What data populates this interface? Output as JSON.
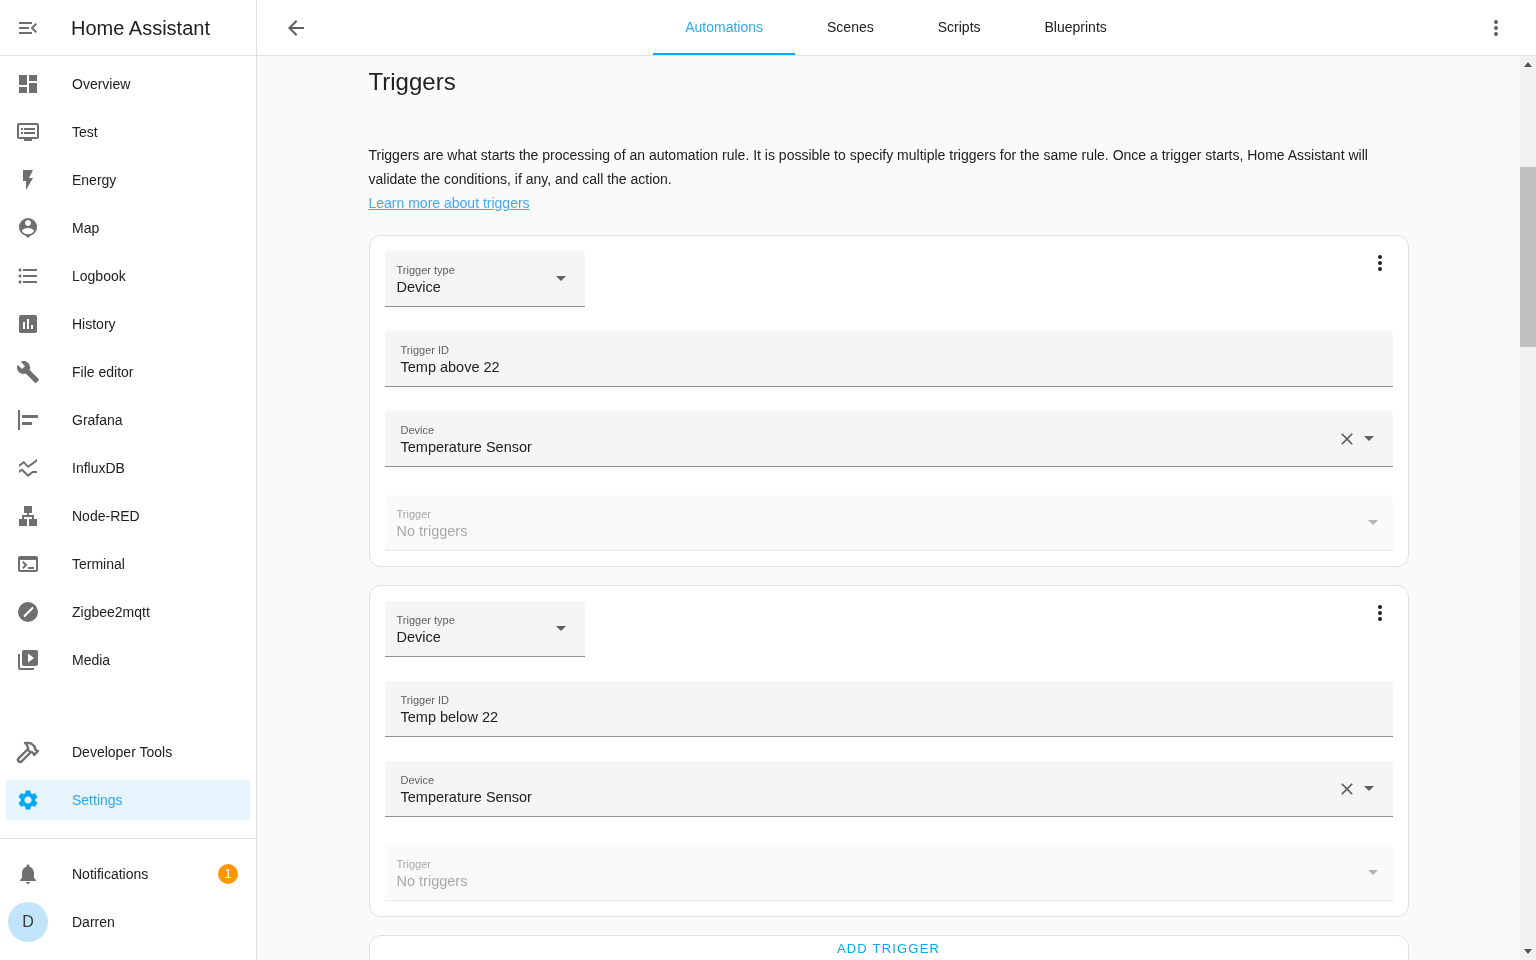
{
  "sidebar": {
    "title": "Home Assistant",
    "panels": [
      {
        "label": "Overview",
        "selected": false
      },
      {
        "label": "Test",
        "selected": false
      },
      {
        "label": "Energy",
        "selected": false
      },
      {
        "label": "Map",
        "selected": false
      },
      {
        "label": "Logbook",
        "selected": false
      },
      {
        "label": "History",
        "selected": false
      },
      {
        "label": "File editor",
        "selected": false
      },
      {
        "label": "Grafana",
        "selected": false
      },
      {
        "label": "InfluxDB",
        "selected": false
      },
      {
        "label": "Node-RED",
        "selected": false
      },
      {
        "label": "Terminal",
        "selected": false
      },
      {
        "label": "Zigbee2mqtt",
        "selected": false
      },
      {
        "label": "Media",
        "selected": false
      }
    ],
    "system_panels": [
      {
        "label": "Developer Tools",
        "selected": false
      },
      {
        "label": "Settings",
        "selected": true
      }
    ],
    "notifications": {
      "label": "Notifications",
      "badge": "1"
    },
    "user": {
      "name": "Darren",
      "initial": "D"
    }
  },
  "top_bar": {
    "tabs": [
      {
        "label": "Automations",
        "selected": true
      },
      {
        "label": "Scenes",
        "selected": false
      },
      {
        "label": "Scripts",
        "selected": false
      },
      {
        "label": "Blueprints",
        "selected": false
      }
    ]
  },
  "content": {
    "heading": "Triggers",
    "description": "Triggers are what starts the processing of an automation rule. It is possible to specify multiple triggers for the same rule. Once a trigger starts, Home Assistant will validate the conditions, if any, and call the action.",
    "link": "Learn more about triggers",
    "triggers": [
      {
        "type_field": {
          "label": "Trigger type",
          "value": "Device"
        },
        "fields": [
          {
            "kind": "text",
            "label": "Trigger ID",
            "value": "Temp above 22",
            "disabled": false
          },
          {
            "kind": "device",
            "label": "Device",
            "value": "Temperature Sensor",
            "disabled": false
          },
          {
            "kind": "select",
            "label": "Trigger",
            "value": "No triggers",
            "disabled": true
          }
        ]
      },
      {
        "type_field": {
          "label": "Trigger type",
          "value": "Device"
        },
        "fields": [
          {
            "kind": "text",
            "label": "Trigger ID",
            "value": "Temp below 22",
            "disabled": false
          },
          {
            "kind": "device",
            "label": "Device",
            "value": "Temperature Sensor",
            "disabled": false
          },
          {
            "kind": "select",
            "label": "Trigger",
            "value": "No triggers",
            "disabled": true
          }
        ]
      }
    ],
    "add_button": "ADD TRIGGER"
  }
}
